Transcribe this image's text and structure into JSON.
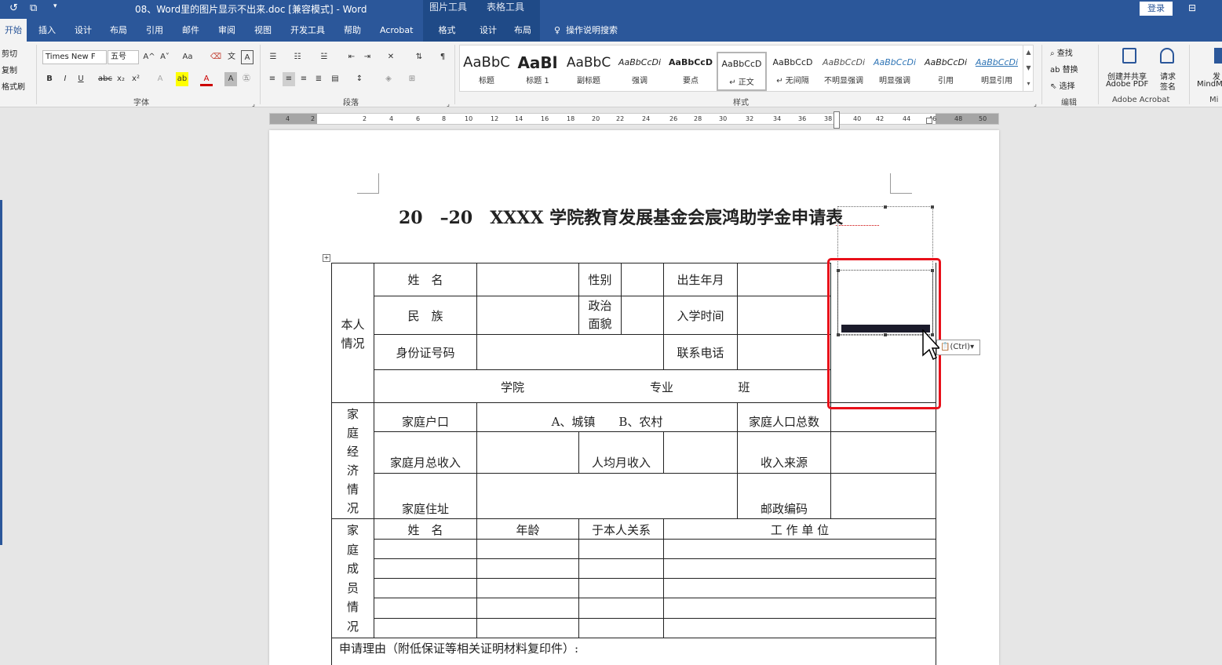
{
  "titlebar": {
    "doc_title": "08、Word里的图片显示不出来.doc [兼容模式] - Word",
    "picture_tools": "图片工具",
    "table_tools": "表格工具",
    "login": "登录",
    "dropdown_glyph": "▾"
  },
  "tabs": [
    "开始",
    "插入",
    "设计",
    "布局",
    "引用",
    "邮件",
    "审阅",
    "视图",
    "开发工具",
    "帮助",
    "Acrobat",
    "格式",
    "设计",
    "布局"
  ],
  "tell_me": "操作说明搜索",
  "clipboard": {
    "cut": "剪切",
    "copy": "复制",
    "painter": "格式刷"
  },
  "font": {
    "name": "Times New F",
    "size": "五号",
    "group": "字体",
    "grow": "A^",
    "shrink": "A˅",
    "case": "Aa",
    "bold": "B",
    "italic": "I",
    "underline": "U",
    "strike": "abc",
    "sub": "x₂",
    "sup": "x²"
  },
  "paragraph": {
    "group": "段落"
  },
  "styles": {
    "group": "样式",
    "items": [
      {
        "preview": "AaBbC",
        "name": "标题"
      },
      {
        "preview": "AaBl",
        "name": "标题 1"
      },
      {
        "preview": "AaBbC",
        "name": "副标题"
      },
      {
        "preview": "AaBbCcDi",
        "name": "强调"
      },
      {
        "preview": "AaBbCcD",
        "name": "要点"
      },
      {
        "preview": "AaBbCcD",
        "name": "↵ 正文"
      },
      {
        "preview": "AaBbCcD",
        "name": "↵ 无间隔"
      },
      {
        "preview": "AaBbCcDi",
        "name": "不明显强调"
      },
      {
        "preview": "AaBbCcDi",
        "name": "明显强调"
      },
      {
        "preview": "AaBbCcDi",
        "name": "引用"
      },
      {
        "preview": "AaBbCcDi",
        "name": "明显引用"
      }
    ]
  },
  "editing": {
    "find": "查找",
    "replace": "替换",
    "select": "选择",
    "group": "编辑"
  },
  "acrobat": {
    "create": "创建并共享",
    "create2": "Adobe PDF",
    "sign": "请求",
    "sign2": "签名",
    "group": "Adobe Acrobat"
  },
  "extra": {
    "send": "发",
    "mind": "MindM",
    "mi": "Mi"
  },
  "ruler": [
    "4",
    "2",
    "2",
    "4",
    "6",
    "8",
    "10",
    "12",
    "14",
    "16",
    "18",
    "20",
    "22",
    "24",
    "26",
    "28",
    "30",
    "32",
    "34",
    "36",
    "38",
    "40",
    "42",
    "44",
    "46",
    "48",
    "50"
  ],
  "doc": {
    "heading": "20　–20　XXXX 学院教育发展基金会宸鸿助学金申请表",
    "paste_ctrl": "(Ctrl)",
    "cells": {
      "ben_ren": "本人\n情况",
      "name": "姓　名",
      "gender": "性别",
      "birth": "出生年月",
      "ethnic": "民　族",
      "politic": "政治\n面貌",
      "enroll": "入学时间",
      "id": "身份证号码",
      "phone": "联系电话",
      "college": "学院",
      "major": "专业",
      "klass": "班",
      "jiating_jj": "家\n庭\n经\n济\n情\n况",
      "hukou": "家庭户口",
      "hukou_opts": "A、城镇　　B、农村",
      "family_count": "家庭人口总数",
      "month_income": "家庭月总收入",
      "per_income": "人均月收入",
      "source": "收入来源",
      "address": "家庭住址",
      "postcode": "邮政编码",
      "jiating_cy": "家\n庭\n成\n员\n情\n况",
      "m_name": "姓　名",
      "m_age": "年龄",
      "m_rel": "于本人关系",
      "m_work": "工 作 单 位",
      "reason": "申请理由（附低保证等相关证明材料复印件）:"
    }
  }
}
